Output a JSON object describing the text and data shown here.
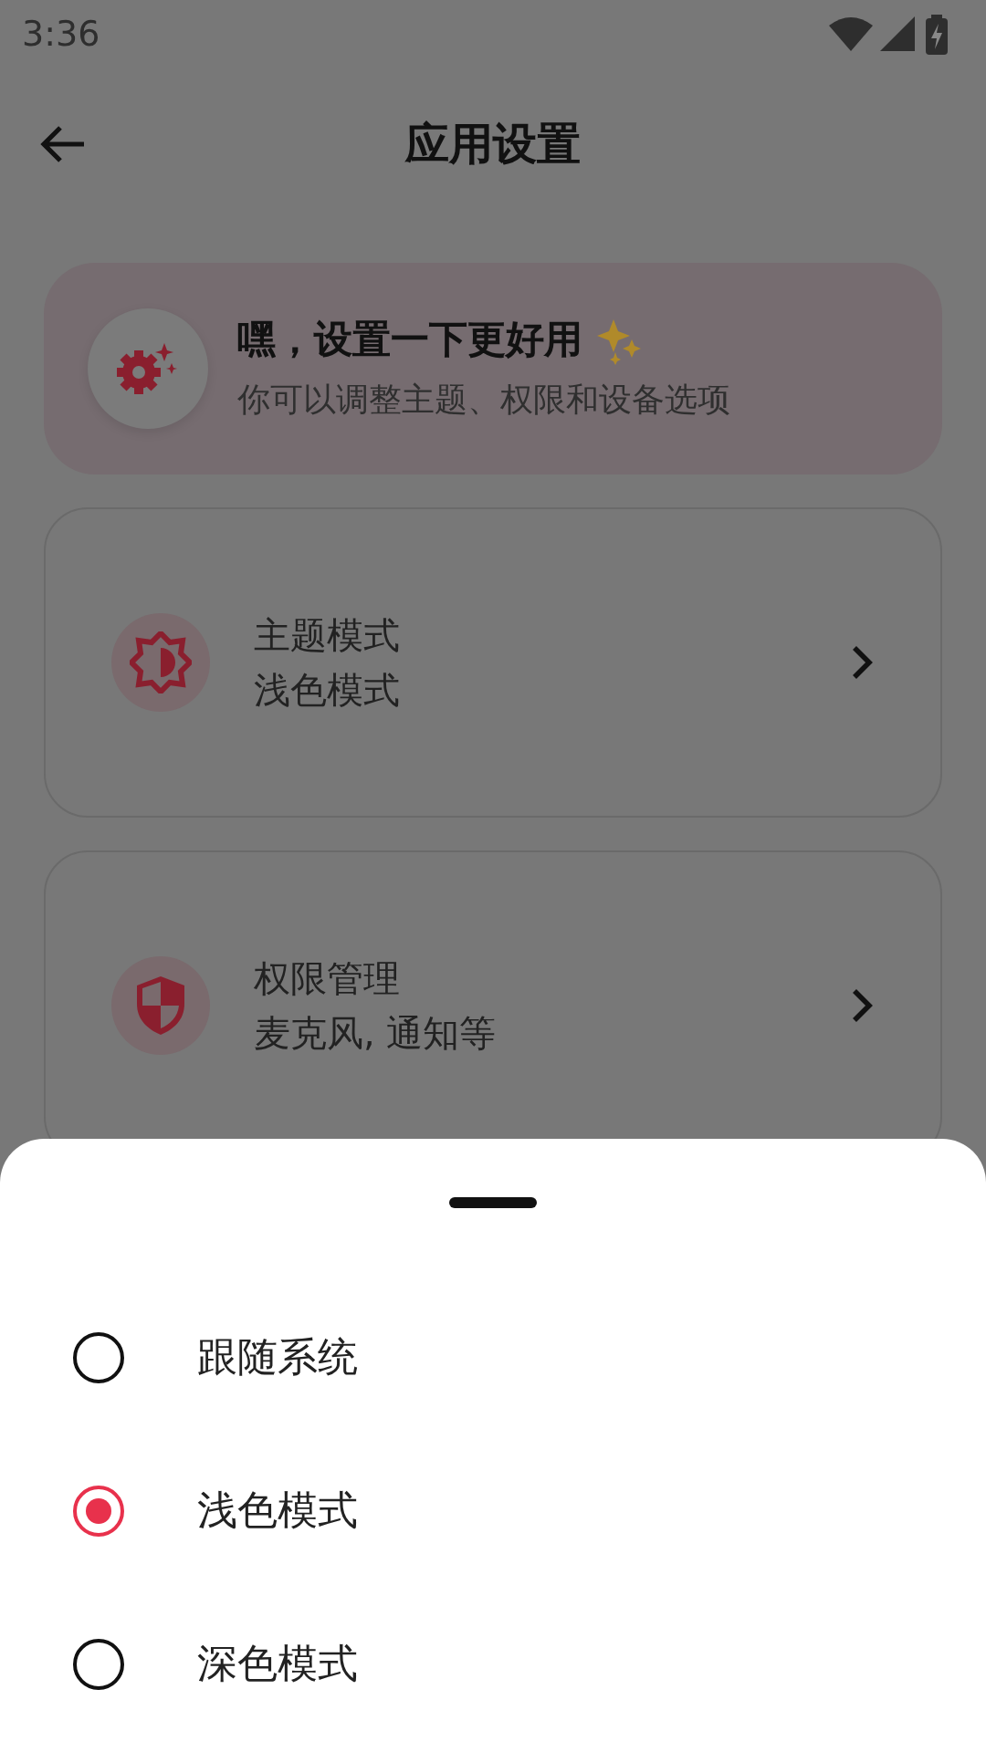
{
  "status_bar": {
    "time": "3:36"
  },
  "app_bar": {
    "title": "应用设置"
  },
  "banner": {
    "title": "嘿，设置一下更好用",
    "subtitle": "你可以调整主题、权限和设备选项"
  },
  "settings": [
    {
      "kind": "theme",
      "title": "主题模式",
      "value": "浅色模式"
    },
    {
      "kind": "permission",
      "title": "权限管理",
      "value": "麦克风, 通知等"
    }
  ],
  "sheet": {
    "options": [
      {
        "label": "跟随系统",
        "selected": false
      },
      {
        "label": "浅色模式",
        "selected": true
      },
      {
        "label": "深色模式",
        "selected": false
      }
    ]
  }
}
